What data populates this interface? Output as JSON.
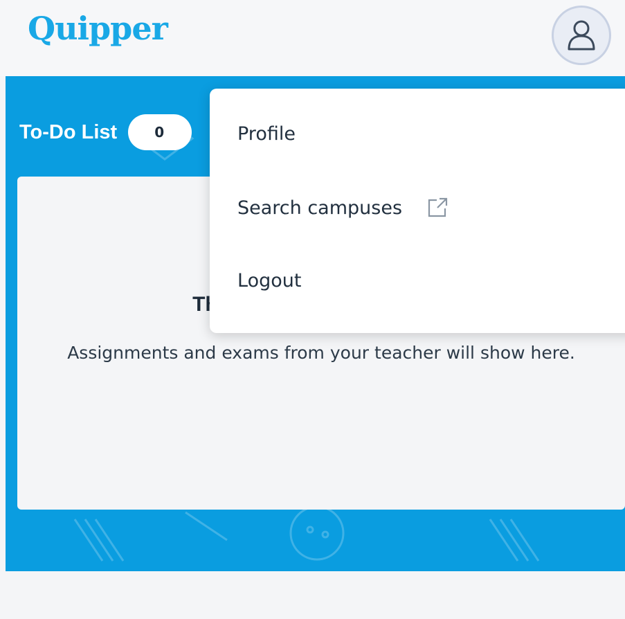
{
  "header": {
    "logo_text": "Quipper",
    "avatar_icon": "user-icon"
  },
  "todo": {
    "title": "To-Do List",
    "count": "0"
  },
  "empty_state": {
    "title": "There are no assignments",
    "description": "Assignments and exams from your teacher will show here."
  },
  "menu": {
    "items": [
      {
        "label": "Profile"
      },
      {
        "label": "Search campuses",
        "icon": "external-link-icon"
      },
      {
        "label": "Logout"
      }
    ]
  },
  "colors": {
    "brand": "#19a8e6",
    "banner": "#0a9de0",
    "text": "#1d2b3a"
  }
}
